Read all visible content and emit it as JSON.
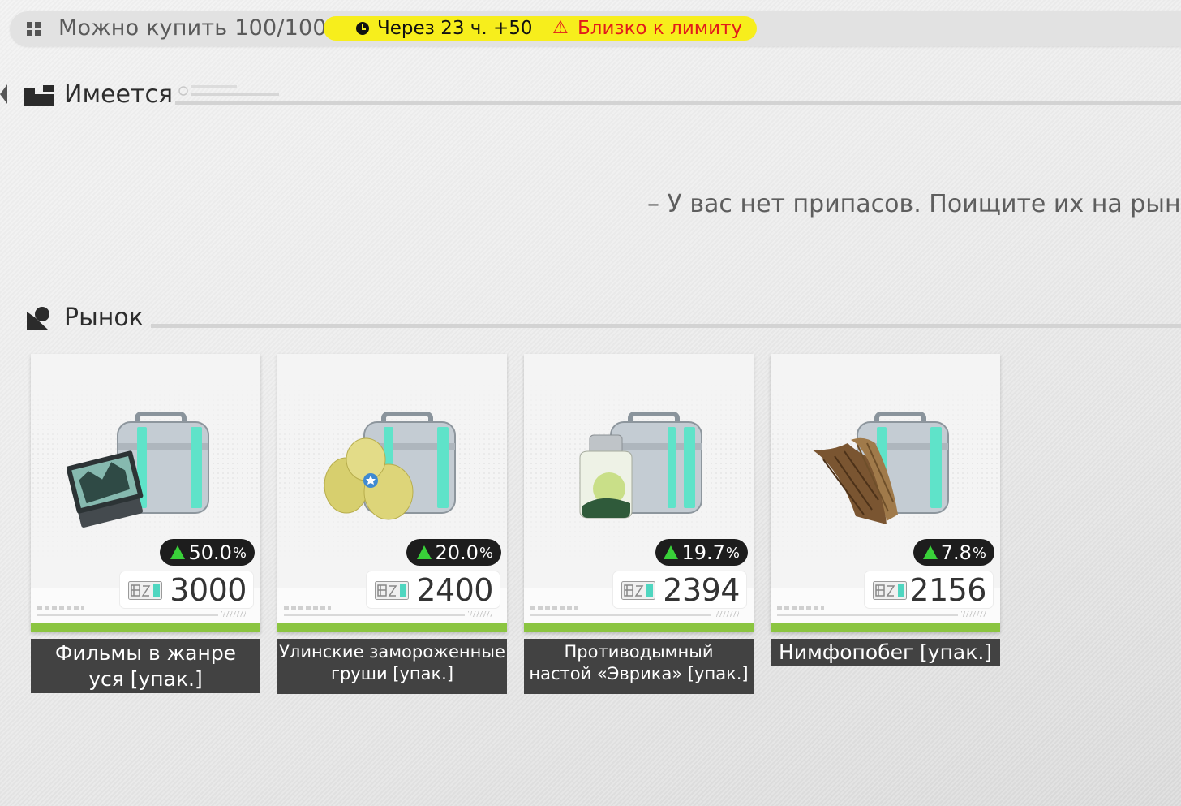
{
  "topbar": {
    "buy_label": "Можно купить 100/100",
    "timer": "Через 23 ч. +50",
    "warning_symbol": "⚠",
    "warning": "Близко к лимиту"
  },
  "owned": {
    "title": "Имеется",
    "empty_message": "– У вас нет припасов. Поищите их на рынке. –"
  },
  "market": {
    "title": "Рынок",
    "items": [
      {
        "name": "Фильмы в жанре\nуся [упак.]",
        "change_value": "50.0",
        "change_unit": "%",
        "change_dir": "up",
        "price": "3000",
        "image_icon": "film-reels-crate-icon"
      },
      {
        "name": "Улинские замороженные\nгруши [упак.]",
        "change_value": "20.0",
        "change_unit": "%",
        "change_dir": "up",
        "price": "2400",
        "image_icon": "frozen-pears-crate-icon"
      },
      {
        "name": "Противодымный\nнастой «Эврика» [упак.]",
        "change_value": "19.7",
        "change_unit": "%",
        "change_dir": "up",
        "price": "2394",
        "image_icon": "smoke-tonic-jar-crate-icon"
      },
      {
        "name": "Нимфопобег [упак.]",
        "change_value": "7.8",
        "change_unit": "%",
        "change_dir": "up",
        "price": "2156",
        "image_icon": "bamboo-shoot-crate-icon"
      }
    ]
  },
  "colors": {
    "limit_pill": "#f7ee1c",
    "warning": "#e21b1b",
    "trend_up": "#39d139",
    "card_accent": "#8bc541",
    "name_bar": "#424242"
  }
}
